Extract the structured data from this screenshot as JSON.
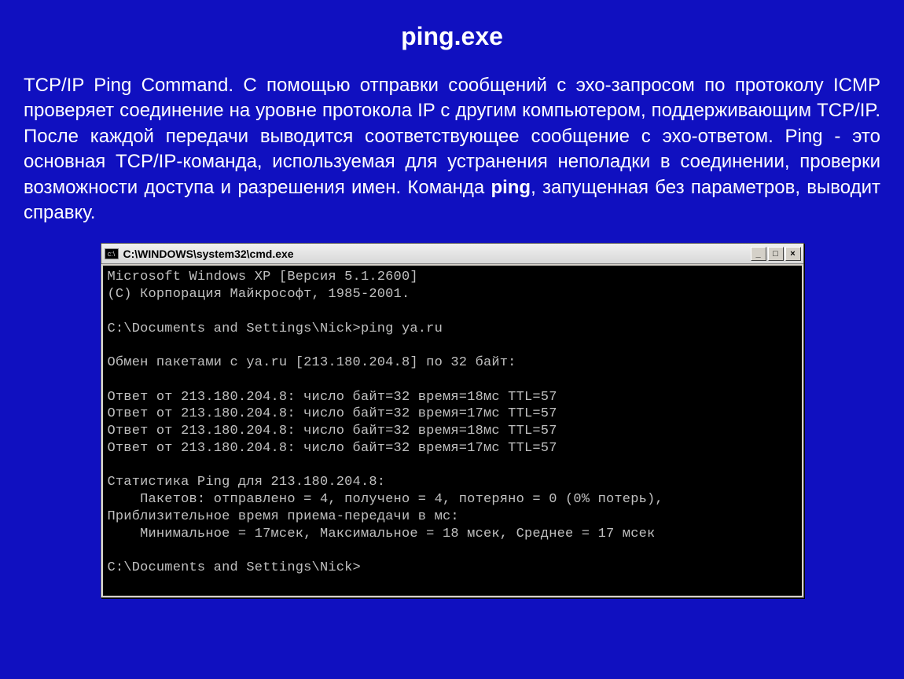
{
  "title": "ping.exe",
  "paragraph": {
    "t1": "TCP/IP Ping Command. С помощью отправки сообщений с эхо-запросом по протоколу ICMP проверяет соединение на уровне протокола IP с другим компьютером, поддерживающим TCP/IP. После каждой передачи выводится соответствующее сообщение с эхо-ответом. Ping - это основная TCP/IP-команда, используемая для устранения неполадки в соединении, проверки возможности доступа и разрешения имен. Команда ",
    "bold": "ping",
    "t2": ", запущенная без параметров, выводит справку."
  },
  "cmd": {
    "window_title": "C:\\WINDOWS\\system32\\cmd.exe",
    "btn_min": "_",
    "btn_max": "□",
    "btn_close": "×",
    "lines": [
      "Microsoft Windows XP [Версия 5.1.2600]",
      "(С) Корпорация Майкрософт, 1985-2001.",
      "",
      "C:\\Documents and Settings\\Nick>ping ya.ru",
      "",
      "Обмен пакетами с ya.ru [213.180.204.8] по 32 байт:",
      "",
      "Ответ от 213.180.204.8: число байт=32 время=18мс TTL=57",
      "Ответ от 213.180.204.8: число байт=32 время=17мс TTL=57",
      "Ответ от 213.180.204.8: число байт=32 время=18мс TTL=57",
      "Ответ от 213.180.204.8: число байт=32 время=17мс TTL=57",
      "",
      "Статистика Ping для 213.180.204.8:",
      "    Пакетов: отправлено = 4, получено = 4, потеряно = 0 (0% потерь),",
      "Приблизительное время приема-передачи в мс:",
      "    Минимальное = 17мсек, Максимальное = 18 мсек, Среднее = 17 мсек",
      "",
      "C:\\Documents and Settings\\Nick>"
    ]
  }
}
